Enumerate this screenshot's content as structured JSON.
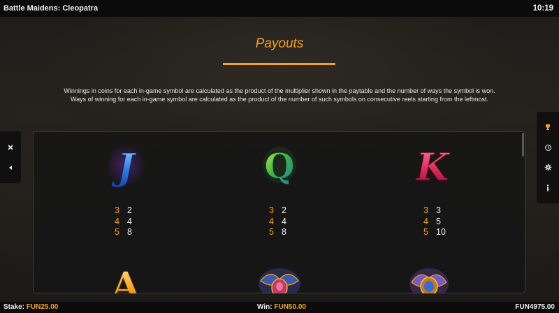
{
  "topbar": {
    "title": "Battle Maidens: Cleopatra",
    "clock": "10:19"
  },
  "heading": "Payouts",
  "description": "Winnings in coins for each in-game symbol are calculated as the product of the multiplier shown in the paytable and the number of ways the symbol is won. Ways of winning for each in-game symbol are calculated as the product of the number of such symbols on consecutive reels starting from the leftmost.",
  "left_controls": [
    {
      "name": "close-icon"
    },
    {
      "name": "triangle-left-icon"
    }
  ],
  "right_controls": [
    {
      "name": "trophy-icon"
    },
    {
      "name": "history-icon"
    },
    {
      "name": "gear-icon"
    },
    {
      "name": "info-icon"
    }
  ],
  "symbols": [
    {
      "letter": "J",
      "color": "#2f7de8",
      "payouts": [
        {
          "count": "3",
          "mult": "2"
        },
        {
          "count": "4",
          "mult": "4"
        },
        {
          "count": "5",
          "mult": "8"
        }
      ]
    },
    {
      "letter": "Q",
      "color": "#3fb83f",
      "payouts": [
        {
          "count": "3",
          "mult": "2"
        },
        {
          "count": "4",
          "mult": "4"
        },
        {
          "count": "5",
          "mult": "8"
        }
      ]
    },
    {
      "letter": "K",
      "color": "#e02a5c",
      "payouts": [
        {
          "count": "3",
          "mult": "3"
        },
        {
          "count": "4",
          "mult": "5"
        },
        {
          "count": "5",
          "mult": "10"
        }
      ]
    },
    {
      "letter": "A",
      "color": "#f5a21a"
    },
    {
      "name": "scarab-icon",
      "color": "#c23a6a"
    },
    {
      "name": "scarab-amulet-icon",
      "color": "#3a6ad6"
    }
  ],
  "bottombar": {
    "stake_label": "Stake:",
    "stake_value": "FUN25.00",
    "win_label": "Win:",
    "win_value": "FUN50.00",
    "balance_value": "FUN4975.00"
  },
  "colors": {
    "accent": "#f5a21a",
    "bar": "#0b0b0b"
  }
}
